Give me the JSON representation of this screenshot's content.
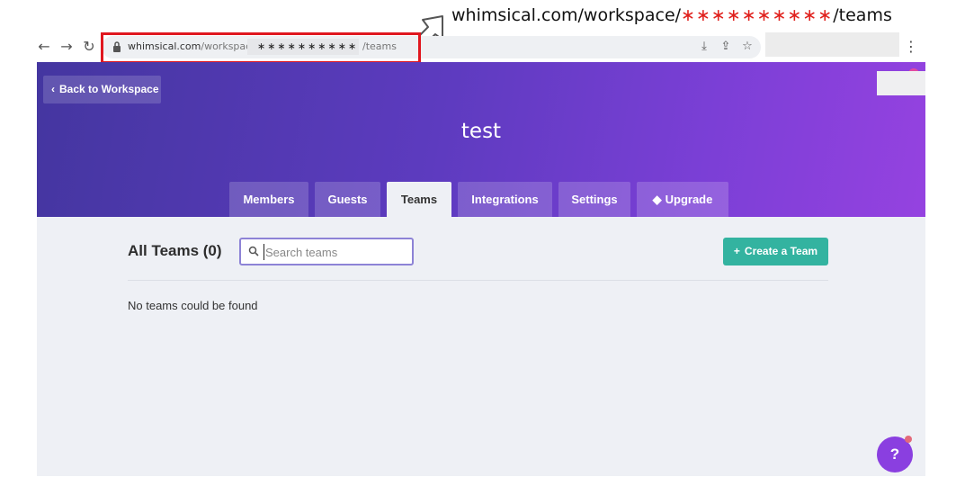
{
  "annotation": {
    "url_prefix": "whimsical.com/workspace/",
    "masked": "∗∗∗∗∗∗∗∗∗∗",
    "url_suffix": "/teams"
  },
  "browser": {
    "url_host": "whimsical.com",
    "url_path_visible": "/workspace/",
    "url_masked": "∗∗∗∗∗∗∗∗∗∗",
    "url_tail": "/teams",
    "icons": [
      "back-icon",
      "forward-icon",
      "reload-icon",
      "lock-icon",
      "install-icon",
      "share-icon",
      "bookmark-star-icon",
      "menu-dots-icon"
    ]
  },
  "header": {
    "back_label": "Back to Workspace",
    "workspace_name": "test"
  },
  "tabs": [
    {
      "label": "Members"
    },
    {
      "label": "Guests"
    },
    {
      "label": "Teams",
      "active": true
    },
    {
      "label": "Integrations"
    },
    {
      "label": "Settings"
    },
    {
      "label": "Upgrade",
      "icon": "diamond-icon"
    }
  ],
  "main": {
    "title": "All Teams (0)",
    "search_placeholder": "Search teams",
    "create_label": "Create a Team",
    "empty_message": "No teams could be found"
  },
  "help": {
    "label": "?"
  },
  "colors": {
    "accent": "#33b3a0",
    "hero_start": "#4436a0",
    "hero_end": "#9542e0",
    "annotation_red": "#e0171f",
    "help": "#8a3fe0"
  }
}
